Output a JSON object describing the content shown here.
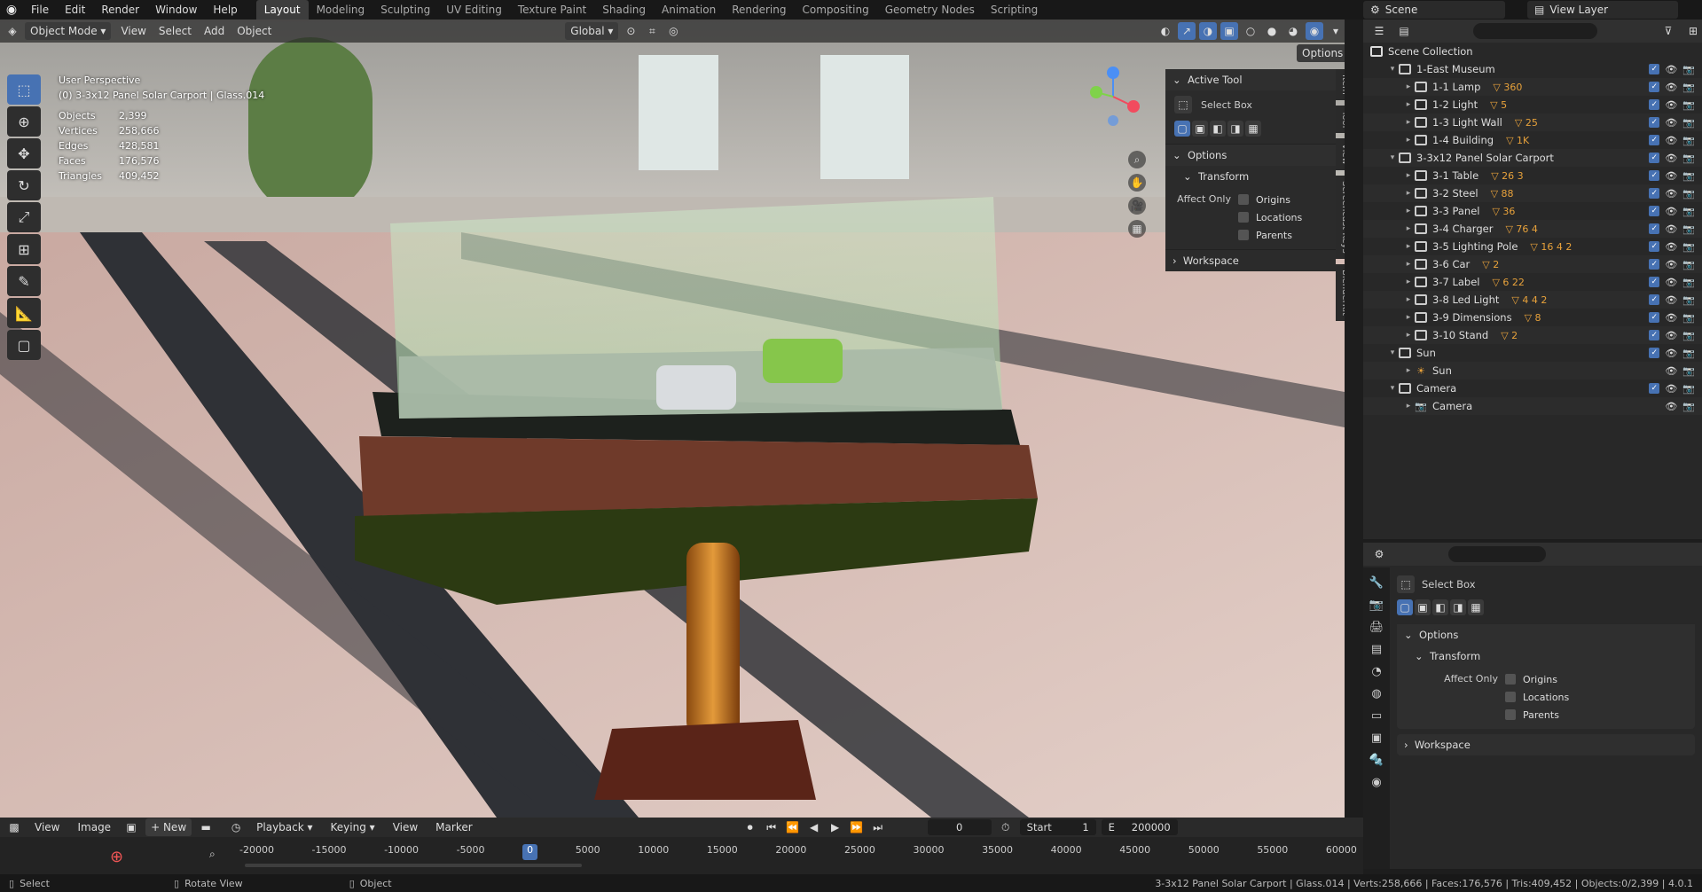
{
  "topbar": {
    "menus": [
      "File",
      "Edit",
      "Render",
      "Window",
      "Help"
    ],
    "workspaces": [
      "Layout",
      "Modeling",
      "Sculpting",
      "UV Editing",
      "Texture Paint",
      "Shading",
      "Animation",
      "Rendering",
      "Compositing",
      "Geometry Nodes",
      "Scripting"
    ],
    "active_workspace": "Layout",
    "scene": "Scene",
    "view_layer": "View Layer"
  },
  "viewport": {
    "mode": "Object Mode",
    "menus": [
      "View",
      "Select",
      "Add",
      "Object"
    ],
    "orientation": "Global",
    "options": "Options",
    "overlay_lines": [
      "User Perspective",
      "(0) 3-3x12 Panel Solar Carport | Glass.014"
    ],
    "stats": [
      {
        "k": "Objects",
        "v": "2,399"
      },
      {
        "k": "Vertices",
        "v": "258,666"
      },
      {
        "k": "Edges",
        "v": "428,581"
      },
      {
        "k": "Faces",
        "v": "176,576"
      },
      {
        "k": "Triangles",
        "v": "409,452"
      }
    ],
    "side_tabs": [
      "Item",
      "Tool",
      "View",
      "Screencast Keys",
      "BlenderKit"
    ]
  },
  "npanel": {
    "active_tool_h": "Active Tool",
    "tool_name": "Select Box",
    "options_h": "Options",
    "transform_h": "Transform",
    "affect_only": "Affect Only",
    "checks": [
      "Origins",
      "Locations",
      "Parents"
    ],
    "workspace_h": "Workspace"
  },
  "outliner": {
    "root": "Scene Collection",
    "rows": [
      {
        "label": "1-East Museum",
        "level": 0,
        "type": "coll",
        "open": true
      },
      {
        "label": "1-1 Lamp",
        "level": 1,
        "type": "coll",
        "badge": "360"
      },
      {
        "label": "1-2 Light",
        "level": 1,
        "type": "coll",
        "badge": "5"
      },
      {
        "label": "1-3 Light Wall",
        "level": 1,
        "type": "coll",
        "badge": "25"
      },
      {
        "label": "1-4 Building",
        "level": 1,
        "type": "coll",
        "badge": "1K"
      },
      {
        "label": "3-3x12 Panel Solar Carport",
        "level": 0,
        "type": "coll",
        "open": true
      },
      {
        "label": "3-1 Table",
        "level": 1,
        "type": "coll",
        "badge": "26 3"
      },
      {
        "label": "3-2 Steel",
        "level": 1,
        "type": "coll",
        "badge": "88"
      },
      {
        "label": "3-3 Panel",
        "level": 1,
        "type": "coll",
        "badge": "36"
      },
      {
        "label": "3-4 Charger",
        "level": 1,
        "type": "coll",
        "badge": "76 4"
      },
      {
        "label": "3-5 Lighting Pole",
        "level": 1,
        "type": "coll",
        "badge": "16 4 2"
      },
      {
        "label": "3-6 Car",
        "level": 1,
        "type": "coll",
        "badge": "2"
      },
      {
        "label": "3-7 Label",
        "level": 1,
        "type": "coll",
        "badge": "6 22"
      },
      {
        "label": "3-8 Led Light",
        "level": 1,
        "type": "coll",
        "badge": "4 4 2"
      },
      {
        "label": "3-9 Dimensions",
        "level": 1,
        "type": "coll",
        "badge": "8"
      },
      {
        "label": "3-10 Stand",
        "level": 1,
        "type": "coll",
        "badge": "2"
      },
      {
        "label": "Sun",
        "level": 0,
        "type": "coll",
        "open": true
      },
      {
        "label": "Sun",
        "level": 1,
        "type": "obj"
      },
      {
        "label": "Camera",
        "level": 0,
        "type": "coll",
        "open": true
      },
      {
        "label": "Camera",
        "level": 1,
        "type": "obj"
      }
    ]
  },
  "props": {
    "tool_name": "Select Box",
    "options_h": "Options",
    "transform_h": "Transform",
    "affect_only": "Affect Only",
    "checks": [
      "Origins",
      "Locations",
      "Parents"
    ],
    "workspace_h": "Workspace"
  },
  "image_editor": {
    "menus": [
      "View",
      "Image"
    ],
    "new": "New"
  },
  "timeline": {
    "menus": [
      "Playback",
      "Keying",
      "View",
      "Marker"
    ],
    "current": "0",
    "start_label": "Start",
    "start": "1",
    "end_label": "E",
    "end": "200000",
    "ticks": [
      "-20000",
      "-15000",
      "-10000",
      "-5000",
      "0",
      "5000",
      "10000",
      "15000",
      "20000",
      "25000",
      "30000",
      "35000",
      "40000",
      "45000",
      "50000",
      "55000",
      "60000"
    ]
  },
  "status": {
    "left": [
      "Select",
      "Rotate View",
      "Object"
    ],
    "right": "3-3x12 Panel Solar Carport | Glass.014 | Verts:258,666 | Faces:176,576 | Tris:409,452 | Objects:0/2,399 | 4.0.1"
  }
}
